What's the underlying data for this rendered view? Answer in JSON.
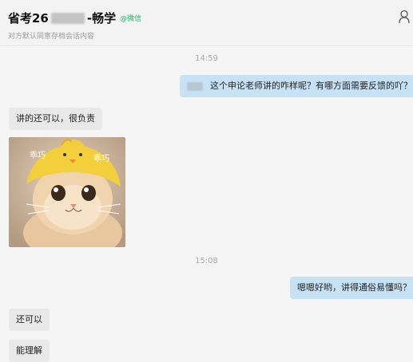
{
  "header": {
    "name_start": "省考26",
    "name_end": "‑畅学",
    "wechat_tag": "@微信",
    "subtitle": "对方默认同意存档会话内容"
  },
  "messages": {
    "time1": "14:59",
    "m1_text": "这个申论老师讲的咋样呢？有哪方面需要反馈的吖？",
    "m2_text": "讲的还可以，很负责",
    "sticker": {
      "label_left": "乖巧",
      "label_right": "乖巧"
    },
    "time2": "15:08",
    "m3_text": "嗯嗯好哟，讲得通俗易懂吗？",
    "m4_text": "还可以",
    "m5_text": "能理解"
  },
  "colors": {
    "right_bubble": "#c7e2f5",
    "left_bubble": "#e9e9e9",
    "wechat_green": "#2aae67"
  },
  "icons": {
    "profile": "user-icon"
  }
}
